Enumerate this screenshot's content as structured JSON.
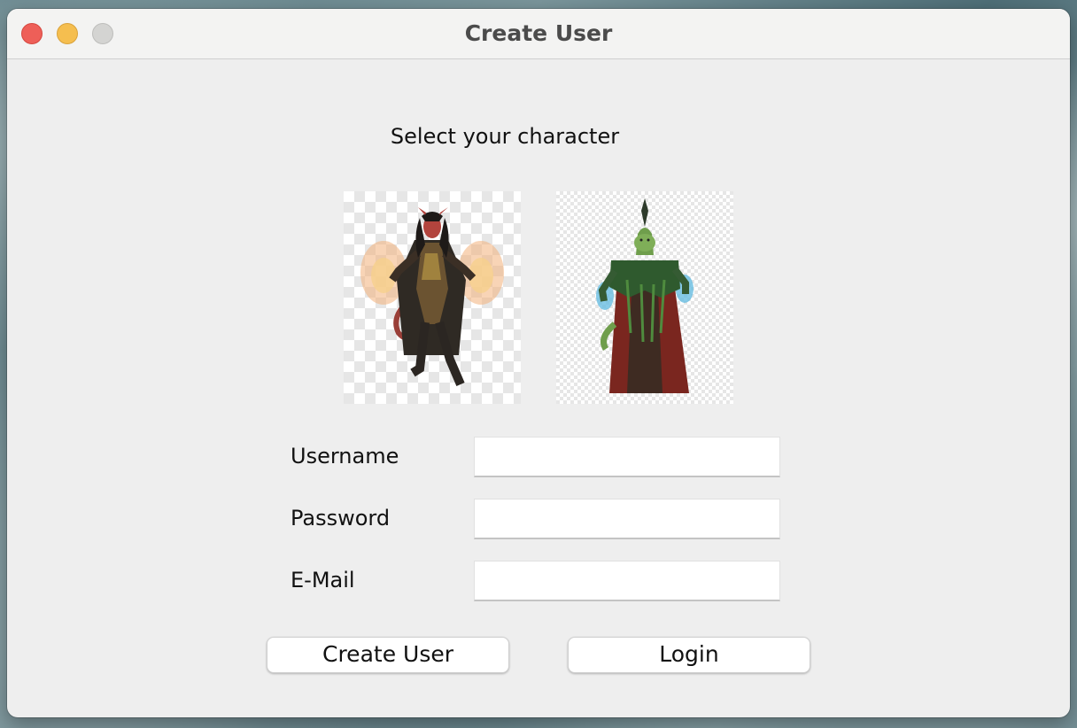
{
  "window": {
    "title": "Create User",
    "traffic_lights": {
      "close": "#ee5f58",
      "minimize": "#f5be4f",
      "zoom": "#d4d4d2"
    }
  },
  "character_select": {
    "prompt": "Select your character",
    "characters": [
      {
        "icon": "tiefling-sorcerer-icon"
      },
      {
        "icon": "lizardfolk-mage-icon"
      }
    ]
  },
  "form": {
    "fields": [
      {
        "label": "Username",
        "value": ""
      },
      {
        "label": "Password",
        "value": ""
      },
      {
        "label": "E-Mail",
        "value": ""
      }
    ]
  },
  "buttons": {
    "create_user": "Create User",
    "login": "Login"
  }
}
